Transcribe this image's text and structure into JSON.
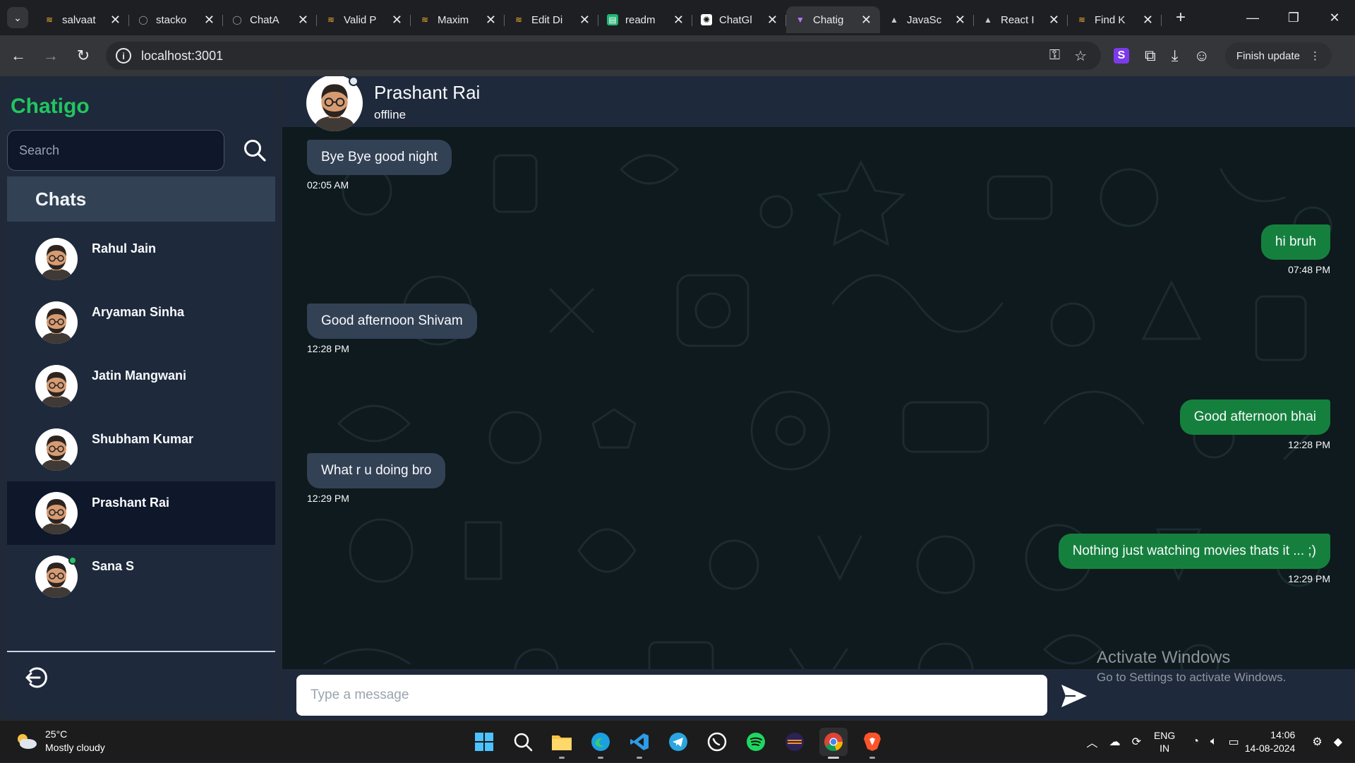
{
  "browser": {
    "tabs": [
      {
        "title": "salvaat",
        "favicon": "codeforces-icon",
        "active": false
      },
      {
        "title": "stacko",
        "favicon": "github-icon",
        "active": false
      },
      {
        "title": "ChatA",
        "favicon": "github-icon",
        "active": false
      },
      {
        "title": "Valid P",
        "favicon": "codeforces-icon",
        "active": false
      },
      {
        "title": "Maxim",
        "favicon": "codeforces-icon",
        "active": false
      },
      {
        "title": "Edit Di",
        "favicon": "codeforces-icon",
        "active": false
      },
      {
        "title": "readm",
        "favicon": "docs-icon",
        "active": false
      },
      {
        "title": "ChatGl",
        "favicon": "chatgpt-icon",
        "active": false
      },
      {
        "title": "Chatig",
        "favicon": "vite-icon",
        "active": true
      },
      {
        "title": "JavaSc",
        "favicon": "mountain-icon",
        "active": false
      },
      {
        "title": "React I",
        "favicon": "mountain-icon",
        "active": false
      },
      {
        "title": "Find K",
        "favicon": "codeforces-icon",
        "active": false
      }
    ],
    "url": "localhost:3001",
    "update_label": "Finish update"
  },
  "app": {
    "brand": "Chatigo",
    "search": {
      "placeholder": "Search",
      "value": ""
    },
    "chats_title": "Chats",
    "contacts": [
      {
        "name": "Rahul Jain",
        "online": false,
        "selected": false
      },
      {
        "name": "Aryaman Sinha",
        "online": false,
        "selected": false
      },
      {
        "name": "Jatin Mangwani",
        "online": false,
        "selected": false
      },
      {
        "name": "Shubham Kumar",
        "online": false,
        "selected": false
      },
      {
        "name": "Prashant Rai",
        "online": false,
        "selected": true
      },
      {
        "name": "Sana S",
        "online": true,
        "selected": false
      }
    ]
  },
  "chat": {
    "peer_name": "Prashant Rai",
    "peer_status": "offline",
    "messages": [
      {
        "direction": "in",
        "text": "Bye Bye good night",
        "time": "02:05 AM"
      },
      {
        "direction": "out",
        "text": "hi bruh",
        "time": "07:48 PM"
      },
      {
        "direction": "in",
        "text": "Good afternoon Shivam",
        "time": "12:28 PM"
      },
      {
        "direction": "out",
        "text": "Good afternoon bhai",
        "time": "12:28 PM"
      },
      {
        "direction": "in",
        "text": "What r u doing bro",
        "time": "12:29 PM"
      },
      {
        "direction": "out",
        "text": "Nothing just watching movies thats it ... ;)",
        "time": "12:29 PM"
      }
    ],
    "composer_placeholder": "Type a message"
  },
  "watermark": {
    "line1": "Activate Windows",
    "line2": "Go to Settings to activate Windows."
  },
  "taskbar": {
    "weather_temp": "25°C",
    "weather_desc": "Mostly cloudy",
    "lang_line1": "ENG",
    "lang_line2": "IN",
    "time": "14:06",
    "date": "14-08-2024"
  },
  "colors": {
    "brand": "#22c55e",
    "incoming_bubble": "#334155",
    "outgoing_bubble": "#15803d",
    "sidebar_bg": "#1e293b",
    "chat_bg": "#0e1a1d"
  }
}
